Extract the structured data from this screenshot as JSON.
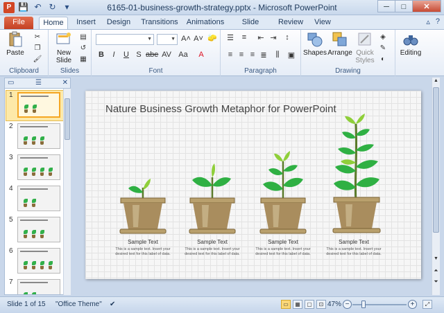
{
  "window": {
    "title": "6165-01-business-growth-strategy.pptx - Microsoft PowerPoint",
    "app_icon": "P"
  },
  "tabs": [
    {
      "label": "File",
      "active": false
    },
    {
      "label": "Home",
      "active": true
    },
    {
      "label": "Insert",
      "active": false
    },
    {
      "label": "Design",
      "active": false
    },
    {
      "label": "Transitions",
      "active": false
    },
    {
      "label": "Animations",
      "active": false
    },
    {
      "label": "Slide Show",
      "active": false
    },
    {
      "label": "Review",
      "active": false
    },
    {
      "label": "View",
      "active": false
    }
  ],
  "ribbon": {
    "clipboard": {
      "label": "Clipboard",
      "paste": "Paste"
    },
    "slides": {
      "label": "Slides",
      "new_slide_line1": "New",
      "new_slide_line2": "Slide"
    },
    "font": {
      "label": "Font"
    },
    "paragraph": {
      "label": "Paragraph"
    },
    "drawing": {
      "label": "Drawing",
      "shapes": "Shapes",
      "arrange": "Arrange",
      "quick_styles_line1": "Quick",
      "quick_styles_line2": "Styles"
    },
    "editing": {
      "label": "Editing"
    }
  },
  "slide_pane": {
    "numbers": [
      "1",
      "2",
      "3",
      "4",
      "5",
      "6",
      "7"
    ]
  },
  "slide": {
    "title": "Nature Business Growth Metaphor for PowerPoint",
    "items": [
      {
        "label": "Sample Text",
        "desc": "This is a sample text. Insert your desired text for this label of data."
      },
      {
        "label": "Sample Text",
        "desc": "This is a sample text. Insert your desired text for this label of data."
      },
      {
        "label": "Sample Text",
        "desc": "This is a sample text. Insert your desired text for this label of data."
      },
      {
        "label": "Sample Text",
        "desc": "This is a sample text. Insert your desired text for this label of data."
      }
    ]
  },
  "status": {
    "slide_info": "Slide 1 of 15",
    "theme": "\"Office Theme\"",
    "zoom": "47%"
  },
  "colors": {
    "accent": "#d24726",
    "leaf": "#2fb043",
    "leaf_light": "#8fcf3a",
    "pot": "#a98d5e",
    "ribbon_bg": "#dfe9f5"
  }
}
